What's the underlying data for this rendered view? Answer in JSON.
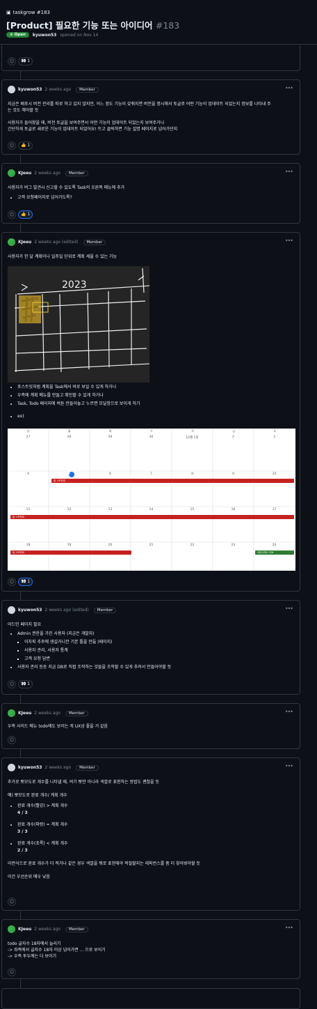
{
  "header": {
    "repo": "taskgrow #183",
    "title": "[Product] 필요한 기능 또는 아이디어",
    "number": "#183",
    "status": "Open",
    "author": "kyuwon53",
    "opened": "opened on Nov 14"
  },
  "top_reactions": {
    "eyes": "👀 1"
  },
  "comments": [
    {
      "author": "kyuwon53",
      "time": "2 weeks ago",
      "role": "Member",
      "lines": [
        "지금은 배포시 버전 관리를 따로 하고 있지 않지만, 어느 정도 기능이 갖춰지면 버전을 명시해서 토글로 어떤 기능이 업데이트 되었는지 정보를 나타내 주",
        "는 것도 해야할 듯",
        "",
        "사용자가 들어왔을 때, 버전 토글을 보여주면서 어떤 기능이 업데이트 되었는지 보여주거나",
        "간단하게 토글로 새로운 기능이 업데이트 되었어요! 뜨고 클릭하면 기능 설명 페이지로 넘어가던지"
      ],
      "reaction": "👍 1"
    },
    {
      "author": "KJeeu",
      "time": "2 weeks ago",
      "role": "Member",
      "text": "사용자가 버그 발견시 신고할 수 있도록 Task의 오른쪽 메뉴에 추가",
      "bullets": [
        "고객 요청페이지로 넘어가도록?"
      ],
      "reaction": "👍 1"
    },
    {
      "author": "KJeeu",
      "time": "2 weeks ago (edited)",
      "role": "Member",
      "text": "사용자가 한 달 계획이나 일주일 단위로 계획 세울 수 있는 기능",
      "bullets": [
        "포스트잇처럼 계획을 Task에서 바로 보일 수 있게 하거나",
        "우측에 계획 메뉴를 만들고 확인할 수 있게 하거나",
        "Task, Todo 페이지에 버튼 만들어놓고 누르면 모달창으로 보이게 하기"
      ],
      "extra": "ex)",
      "sketch_year": "2023",
      "calendar": {
        "weekdays": [
          "일",
          "월",
          "화",
          "수",
          "목",
          "금",
          "토"
        ],
        "weeks": [
          [
            "27",
            "28",
            "29",
            "30",
            "12월 1일",
            "2",
            "3"
          ],
          [
            "4",
            "5",
            "6",
            "7",
            "8",
            "9",
            "10"
          ],
          [
            "11",
            "12",
            "13",
            "14",
            "15",
            "16",
            "17"
          ],
          [
            "18",
            "19",
            "20",
            "21",
            "22",
            "23",
            "24"
          ]
        ],
        "events": {
          "study": "팀 스프린트",
          "xmas": "크리스마스 이브"
        },
        "colors": {
          "red": "#c5221f",
          "green": "#2e7d32",
          "today": "#1a73e8"
        }
      },
      "reaction": "👀 1"
    },
    {
      "author": "kyuwon53",
      "time": "2 weeks ago (edited)",
      "role": "Member",
      "text": "어드민 페이지 필요",
      "bullets": [
        "Admin 권한을 가진 사용자 (지금은 개발자)"
      ],
      "sub_bullets": [
        "이차피 추후에 생길거니깐 기본 틀을 만듦 (페이지)",
        "사용자 관리, 사용자 통계",
        "고객 요청 답변"
      ],
      "bullets2": [
        "사용자 관리 등등 지금 DB로 직접 조작하는 것들을 조작할 수 있게 추려서 만들어야할 듯"
      ],
      "reaction": "👀 1"
    },
    {
      "author": "KJeeu",
      "time": "2 weeks ago",
      "role": "Member",
      "text": "우측 사이드 메뉴 todo에도 보이는 게 UX상 좋을 거 같음"
    },
    {
      "author": "kyuwon53",
      "time": "2 weeks ago",
      "role": "Member",
      "text": "추가로 뽀모도로 개수를 나타낼 때, 여기 뽀만 아니라 색깔로 표현하는 방법도 괜찮을 듯",
      "example": "예) 뽀모도로 완료 개수/ 계획 개수",
      "items": [
        {
          "label": "완료 개수(빨강) > 계획 개수",
          "val": "4 / 3"
        },
        {
          "label": "완료 개수(파랑) = 계획 개수",
          "val": "3 / 3"
        },
        {
          "label": "완료 개수(초록) < 계획 개수",
          "val": "2 / 3"
        }
      ],
      "p1": "이런식으로 완료 개수가 더 적거나 같은 경우 색깔을 뭐로 표현해야 적절할지는 레퍼런스를 좀 더 찾아봐야할 듯",
      "p2": "이건 우선순위 매우 낮음"
    },
    {
      "author": "KJeeu",
      "time": "2 weeks ago",
      "role": "Member",
      "lines": [
        "todo 글자수 18자에서 늘리기",
        "-> 좌측에서 글자수 18자 이상 넘어가면 ... 으로 보이기",
        "-> 우측 투두에는 다 보이기"
      ]
    }
  ]
}
